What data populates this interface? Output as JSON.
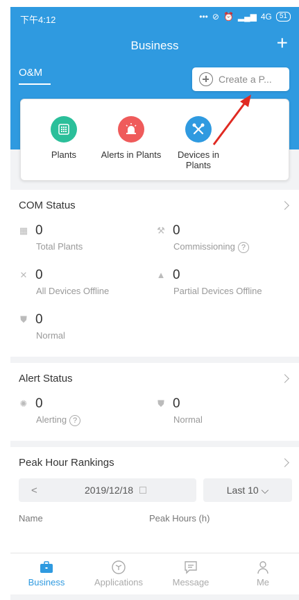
{
  "status_bar": {
    "time": "下午4:12",
    "network": "4G",
    "battery": "51"
  },
  "header": {
    "title": "Business",
    "plus": "+"
  },
  "tabs": [
    {
      "label": "O&M",
      "active": true
    }
  ],
  "create_button": {
    "label": "Create a P..."
  },
  "quick_actions": [
    {
      "label": "Plants",
      "icon": "grid-building-icon",
      "color": "#2bbf9a"
    },
    {
      "label": "Alerts in Plants",
      "icon": "alarm-siren-icon",
      "color": "#ef5b5b"
    },
    {
      "label": "Devices in Plants",
      "icon": "tools-icon",
      "color": "#2f9ae0"
    }
  ],
  "com_status": {
    "title": "COM Status",
    "items": [
      {
        "value": "0",
        "label": "Total Plants",
        "icon": "plants-icon"
      },
      {
        "value": "0",
        "label": "Commissioning",
        "icon": "hammer-icon",
        "help": "?"
      },
      {
        "value": "0",
        "label": "All Devices Offline",
        "icon": "x-icon"
      },
      {
        "value": "0",
        "label": "Partial Devices Offline",
        "icon": "warning-icon"
      },
      {
        "value": "0",
        "label": "Normal",
        "icon": "shield-icon"
      }
    ]
  },
  "alert_status": {
    "title": "Alert Status",
    "items": [
      {
        "value": "0",
        "label": "Alerting",
        "icon": "siren-icon",
        "help": "?"
      },
      {
        "value": "0",
        "label": "Normal",
        "icon": "shield-icon"
      }
    ]
  },
  "peak_hour": {
    "title": "Peak Hour Rankings",
    "prev": "<",
    "date": "2019/12/18",
    "range": "Last 10",
    "columns": [
      "Name",
      "Peak Hours (h)"
    ]
  },
  "bottom_nav": [
    {
      "label": "Business",
      "icon": "briefcase-icon",
      "active": true
    },
    {
      "label": "Applications",
      "icon": "cube-icon",
      "active": false
    },
    {
      "label": "Message",
      "icon": "message-icon",
      "active": false
    },
    {
      "label": "Me",
      "icon": "person-icon",
      "active": false
    }
  ],
  "colors": {
    "primary": "#2f9ae0",
    "background": "#f2f3f5"
  }
}
